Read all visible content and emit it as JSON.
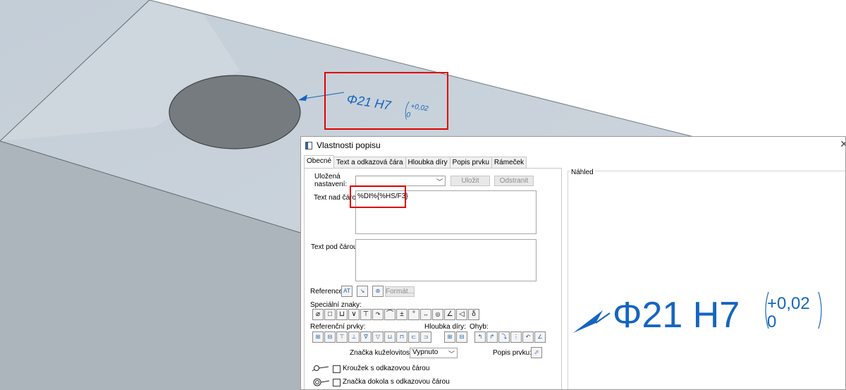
{
  "colors": {
    "dimension_blue": "#1565c0",
    "highlight_red": "#e00000",
    "part_face": "#c9d2da",
    "part_side": "#aeb6bd",
    "hole": "#767b80"
  },
  "model_annotation": {
    "main": "Φ21 H7",
    "tol_upper": "+0,02",
    "tol_lower": "0"
  },
  "dialog": {
    "title": "Vlastnosti popisu",
    "tabs": [
      "Obecné",
      "Text a odkazová čára",
      "Hloubka díry",
      "Popis prvku",
      "Rámeček"
    ],
    "saved_settings_label": "Uložená\nnastavení:",
    "saved_settings_value": "",
    "save_button": "Uložit",
    "remove_button": "Odstranit",
    "text_above_label": "Text nad čárou:",
    "text_above_value": "%DI%{%HS/F3}",
    "text_below_label": "Text pod čárou:",
    "text_below_value": "",
    "reference_label": "Reference:",
    "format_button": "Formát...",
    "special_chars_label": "Speciální znaky:",
    "special_chars_icons": [
      "diameter",
      "square",
      "counterbore",
      "countersink",
      "depth",
      "plus-minus-arc",
      "arc-length",
      "plus-minus",
      "degree",
      "between",
      "spotface",
      "slope",
      "taper",
      "delta"
    ],
    "ref_elements_label": "Referenční prvky:",
    "hole_depth_label": "Hloubka díry:",
    "bend_label": "Ohyb:",
    "taper_mark_label": "Značka kuželovitosti:",
    "taper_mark_value": "Vypnuto",
    "feature_desc_label": "Popis prvku:",
    "circle_leader_label": "Kroužek s odkazovou čárou",
    "around_leader_label": "Značka dokola s odkazovou čárou",
    "preview_label": "Náhled",
    "preview_annotation": {
      "main": "Φ21 H7",
      "tol_upper": "+0,02",
      "tol_lower": "0"
    }
  }
}
